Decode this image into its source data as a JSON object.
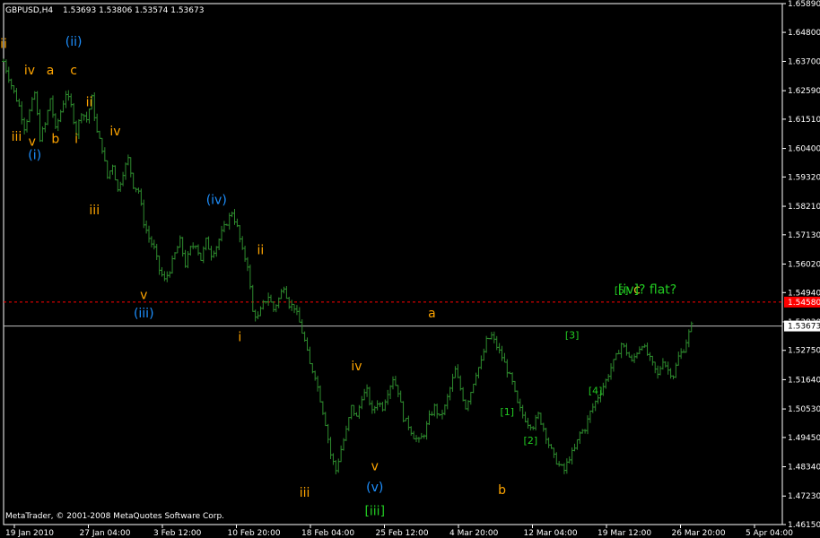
{
  "header": {
    "symbol": "GBPUSD,H4",
    "ohlc": "1.53693 1.53806 1.53574 1.53673"
  },
  "copyright": "MetaTrader, © 2001-2008 MetaQuotes Software Corp.",
  "colors": {
    "background": "#000000",
    "axis": "#ffffff",
    "candle": "#2e8b2e",
    "grid": "#ffffff",
    "red_line": "#ff0000",
    "gray_line": "#c0c0c0",
    "orange": "#ffa500",
    "blue": "#1e90ff",
    "green": "#22cc22",
    "gold": "#e0c020"
  },
  "chart_data": {
    "type": "ohlc",
    "y_ticks": [
      "1.65890",
      "1.64800",
      "1.63700",
      "1.62590",
      "1.61510",
      "1.60400",
      "1.59320",
      "1.58210",
      "1.57130",
      "1.56020",
      "1.54940",
      "1.53830",
      "1.52750",
      "1.51640",
      "1.50530",
      "1.49450",
      "1.48340",
      "1.47230",
      "1.46150"
    ],
    "x_ticks": [
      "19 Jan 2010",
      "27 Jan 04:00",
      "3 Feb 12:00",
      "10 Feb 20:00",
      "18 Feb 04:00",
      "25 Feb 12:00",
      "4 Mar 20:00",
      "12 Mar 04:00",
      "19 Mar 12:00",
      "26 Mar 20:00",
      "5 Apr 04:00"
    ],
    "ylim": [
      1.4615,
      1.6589
    ],
    "red_line_price": "1.54580",
    "current_price": "1.53673",
    "close_path": [
      [
        0,
        1.637
      ],
      [
        3,
        1.628
      ],
      [
        6,
        1.62
      ],
      [
        8,
        1.612
      ],
      [
        10,
        1.618
      ],
      [
        12,
        1.625
      ],
      [
        14,
        1.608
      ],
      [
        16,
        1.613
      ],
      [
        18,
        1.623
      ],
      [
        20,
        1.611
      ],
      [
        22,
        1.618
      ],
      [
        24,
        1.625
      ],
      [
        26,
        1.62
      ],
      [
        28,
        1.61
      ],
      [
        30,
        1.618
      ],
      [
        32,
        1.615
      ],
      [
        34,
        1.623
      ],
      [
        36,
        1.61
      ],
      [
        38,
        1.604
      ],
      [
        40,
        1.593
      ],
      [
        42,
        1.598
      ],
      [
        44,
        1.588
      ],
      [
        46,
        1.595
      ],
      [
        48,
        1.6
      ],
      [
        50,
        1.59
      ],
      [
        52,
        1.588
      ],
      [
        54,
        1.576
      ],
      [
        56,
        1.57
      ],
      [
        58,
        1.566
      ],
      [
        60,
        1.558
      ],
      [
        62,
        1.554
      ],
      [
        64,
        1.558
      ],
      [
        66,
        1.564
      ],
      [
        68,
        1.569
      ],
      [
        70,
        1.56
      ],
      [
        72,
        1.566
      ],
      [
        74,
        1.568
      ],
      [
        76,
        1.562
      ],
      [
        78,
        1.569
      ],
      [
        80,
        1.564
      ],
      [
        82,
        1.567
      ],
      [
        84,
        1.572
      ],
      [
        86,
        1.576
      ],
      [
        88,
        1.58
      ],
      [
        90,
        1.574
      ],
      [
        92,
        1.565
      ],
      [
        94,
        1.56
      ],
      [
        96,
        1.542
      ],
      [
        98,
        1.54
      ],
      [
        100,
        1.545
      ],
      [
        102,
        1.548
      ],
      [
        104,
        1.543
      ],
      [
        106,
        1.547
      ],
      [
        108,
        1.552
      ],
      [
        110,
        1.545
      ],
      [
        112,
        1.544
      ],
      [
        114,
        1.538
      ],
      [
        116,
        1.531
      ],
      [
        118,
        1.522
      ],
      [
        120,
        1.518
      ],
      [
        122,
        1.509
      ],
      [
        124,
        1.5
      ],
      [
        126,
        1.488
      ],
      [
        128,
        1.482
      ],
      [
        130,
        1.49
      ],
      [
        132,
        1.497
      ],
      [
        134,
        1.506
      ],
      [
        136,
        1.502
      ],
      [
        138,
        1.51
      ],
      [
        140,
        1.512
      ],
      [
        142,
        1.504
      ],
      [
        144,
        1.508
      ],
      [
        146,
        1.506
      ],
      [
        148,
        1.512
      ],
      [
        150,
        1.517
      ],
      [
        152,
        1.512
      ],
      [
        154,
        1.502
      ],
      [
        156,
        1.499
      ],
      [
        158,
        1.495
      ],
      [
        160,
        1.493
      ],
      [
        162,
        1.496
      ],
      [
        164,
        1.502
      ],
      [
        166,
        1.506
      ],
      [
        168,
        1.502
      ],
      [
        170,
        1.506
      ],
      [
        172,
        1.513
      ],
      [
        174,
        1.52
      ],
      [
        176,
        1.513
      ],
      [
        178,
        1.506
      ],
      [
        180,
        1.512
      ],
      [
        182,
        1.519
      ],
      [
        184,
        1.523
      ],
      [
        186,
        1.531
      ],
      [
        188,
        1.533
      ],
      [
        190,
        1.529
      ],
      [
        192,
        1.525
      ],
      [
        194,
        1.52
      ],
      [
        196,
        1.515
      ],
      [
        198,
        1.507
      ],
      [
        200,
        1.503
      ],
      [
        202,
        1.5
      ],
      [
        204,
        1.499
      ],
      [
        206,
        1.503
      ],
      [
        208,
        1.498
      ],
      [
        210,
        1.492
      ],
      [
        212,
        1.487
      ],
      [
        214,
        1.484
      ],
      [
        216,
        1.482
      ],
      [
        218,
        1.487
      ],
      [
        220,
        1.49
      ],
      [
        222,
        1.496
      ],
      [
        224,
        1.498
      ],
      [
        226,
        1.504
      ],
      [
        228,
        1.508
      ],
      [
        230,
        1.512
      ],
      [
        232,
        1.516
      ],
      [
        234,
        1.521
      ],
      [
        236,
        1.525
      ],
      [
        238,
        1.53
      ],
      [
        240,
        1.527
      ],
      [
        242,
        1.523
      ],
      [
        244,
        1.527
      ],
      [
        246,
        1.53
      ],
      [
        248,
        1.526
      ],
      [
        250,
        1.522
      ],
      [
        252,
        1.518
      ],
      [
        254,
        1.524
      ],
      [
        256,
        1.52
      ],
      [
        258,
        1.518
      ],
      [
        260,
        1.525
      ],
      [
        262,
        1.528
      ],
      [
        264,
        1.534
      ],
      [
        265,
        1.5367
      ]
    ],
    "wave_labels": [
      {
        "text": "ii",
        "color": "orange",
        "x": 0,
        "y": 1.642
      },
      {
        "text": "iv",
        "color": "orange",
        "x": 10,
        "y": 1.632
      },
      {
        "text": "a",
        "color": "orange",
        "x": 18,
        "y": 1.632
      },
      {
        "text": "(ii)",
        "color": "blue",
        "x": 27,
        "y": 1.643
      },
      {
        "text": "c",
        "color": "orange",
        "x": 27,
        "y": 1.632
      },
      {
        "text": "ii",
        "color": "orange",
        "x": 33,
        "y": 1.62
      },
      {
        "text": "iii",
        "color": "orange",
        "x": 5,
        "y": 1.607
      },
      {
        "text": "v",
        "color": "orange",
        "x": 11,
        "y": 1.605
      },
      {
        "text": "b",
        "color": "orange",
        "x": 20,
        "y": 1.606
      },
      {
        "text": "i",
        "color": "orange",
        "x": 28,
        "y": 1.606
      },
      {
        "text": "(i)",
        "color": "blue",
        "x": 12,
        "y": 1.6
      },
      {
        "text": "iv",
        "color": "orange",
        "x": 43,
        "y": 1.609
      },
      {
        "text": "iii",
        "color": "orange",
        "x": 35,
        "y": 1.579
      },
      {
        "text": "(iv)",
        "color": "blue",
        "x": 82,
        "y": 1.583
      },
      {
        "text": "ii",
        "color": "orange",
        "x": 99,
        "y": 1.564
      },
      {
        "text": "v",
        "color": "orange",
        "x": 54,
        "y": 1.547
      },
      {
        "text": "(iii)",
        "color": "blue",
        "x": 54,
        "y": 1.54
      },
      {
        "text": "i",
        "color": "orange",
        "x": 91,
        "y": 1.531
      },
      {
        "text": "a",
        "color": "orange",
        "x": 165,
        "y": 1.54
      },
      {
        "text": "iv",
        "color": "orange",
        "x": 136,
        "y": 1.52
      },
      {
        "text": "v",
        "color": "orange",
        "x": 143,
        "y": 1.482
      },
      {
        "text": "(v)",
        "color": "blue",
        "x": 143,
        "y": 1.474
      },
      {
        "text": "[iii]",
        "color": "green",
        "x": 143,
        "y": 1.465
      },
      {
        "text": "iii",
        "color": "orange",
        "x": 116,
        "y": 1.472
      },
      {
        "text": "b",
        "color": "orange",
        "x": 192,
        "y": 1.473
      },
      {
        "text": "[1]",
        "color": "green",
        "x": 194,
        "y": 1.503,
        "small": true
      },
      {
        "text": "[2]",
        "color": "green",
        "x": 203,
        "y": 1.492,
        "small": true
      },
      {
        "text": "[3]",
        "color": "green",
        "x": 219,
        "y": 1.532,
        "small": true
      },
      {
        "text": "[4]",
        "color": "green",
        "x": 228,
        "y": 1.511,
        "small": true
      },
      {
        "text": "[5]",
        "color": "green",
        "x": 238,
        "y": 1.549,
        "small": true
      },
      {
        "text": "c",
        "color": "gold",
        "x": 244,
        "y": 1.549
      },
      {
        "text": "[iv]? flat?",
        "color": "green",
        "x": 248,
        "y": 1.549
      }
    ]
  }
}
